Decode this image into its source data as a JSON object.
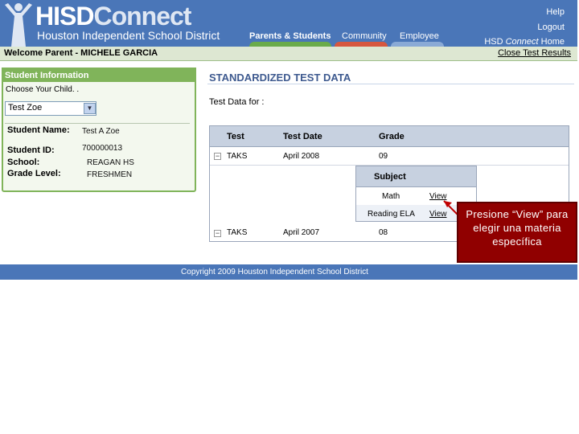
{
  "header": {
    "logo_bold": "HISD",
    "logo_connect": "Connect",
    "district": "Houston Independent School District",
    "nav": [
      "Parents & Students",
      "Community",
      "Employee"
    ],
    "help": "Help",
    "logout": "Logout",
    "home_prefix": "HSD ",
    "home_italic": "Connect",
    "home_suffix": " Home"
  },
  "welcome": {
    "text": "Welcome Parent - MICHELE GARCIA",
    "close_link": "Close Test Results"
  },
  "student_panel": {
    "title": "Student Information",
    "choose_label": "Choose Your Child. .",
    "selected_child": "Test Zoe",
    "name_label": "Student Name:",
    "name_value": "Test A Zoe",
    "id_label": "Student ID:",
    "id_value": "700000013",
    "school_label": "School:",
    "school_value": "REAGAN HS",
    "grade_label": "Grade Level:",
    "grade_value": "FRESHMEN"
  },
  "content": {
    "title": "STANDARDIZED TEST DATA",
    "test_data_for": "Test Data for :",
    "columns": [
      "Test",
      "Test Date",
      "Grade"
    ],
    "rows": [
      {
        "test": "TAKS",
        "date": "April 2008",
        "grade": "09"
      },
      {
        "test": "TAKS",
        "date": "April 2007",
        "grade": "08"
      }
    ],
    "subject_header": "Subject",
    "subjects": [
      {
        "name": "Math",
        "link": "View"
      },
      {
        "name": "Reading ELA",
        "link": "View"
      }
    ]
  },
  "callout": {
    "text": "Presione “View” para elegir una materia específica"
  },
  "footer": {
    "text": "Copyright 2009 Houston Independent School District"
  },
  "colors": {
    "header_blue": "#4a76b8",
    "panel_green": "#80b45a",
    "callout_red": "#900000"
  }
}
